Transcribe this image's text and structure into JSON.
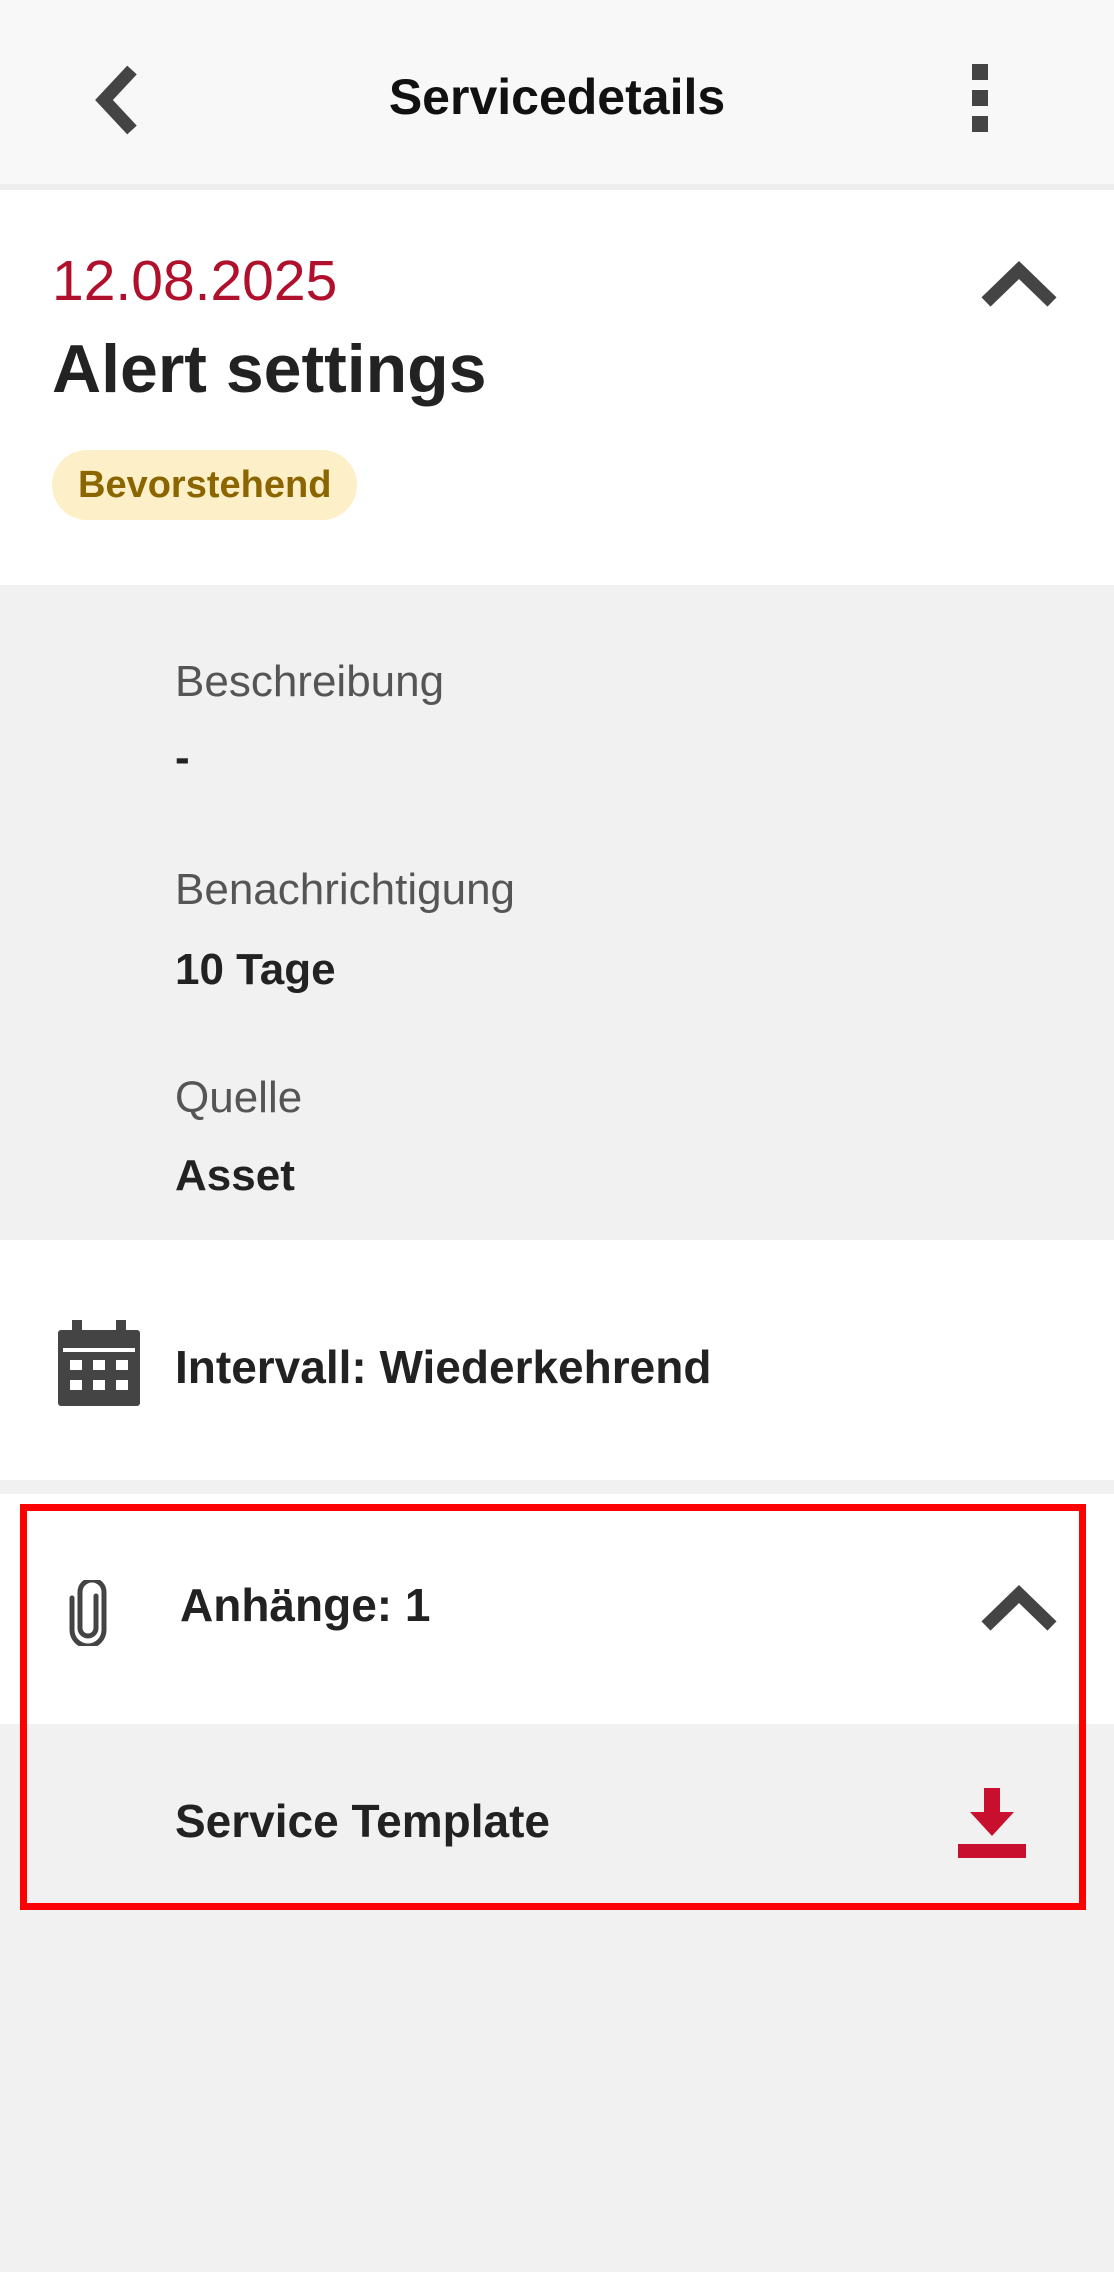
{
  "header": {
    "title": "Servicedetails",
    "back_icon": "chevron-left-icon",
    "menu_icon": "more-vertical-icon"
  },
  "summary": {
    "date": "12.08.2025",
    "title": "Alert settings",
    "status_badge": "Bevorstehend",
    "collapse_icon": "chevron-up-icon"
  },
  "details": {
    "fields": [
      {
        "label": "Beschreibung",
        "value": "-"
      },
      {
        "label": "Benachrichtigung",
        "value": "10 Tage"
      },
      {
        "label": "Quelle",
        "value": "Asset"
      }
    ]
  },
  "interval": {
    "icon": "calendar-icon",
    "label": "Intervall: Wiederkehrend"
  },
  "attachments": {
    "icon": "paperclip-icon",
    "label": "Anhänge: 1",
    "collapse_icon": "chevron-up-icon",
    "items": [
      {
        "name": "Service Template",
        "action_icon": "download-icon"
      }
    ]
  },
  "colors": {
    "accent_red": "#b0102b",
    "badge_bg": "#fdf0c8",
    "badge_text": "#8a6500",
    "panel_bg": "#f2f1f1",
    "highlight_border": "#ff0000"
  }
}
